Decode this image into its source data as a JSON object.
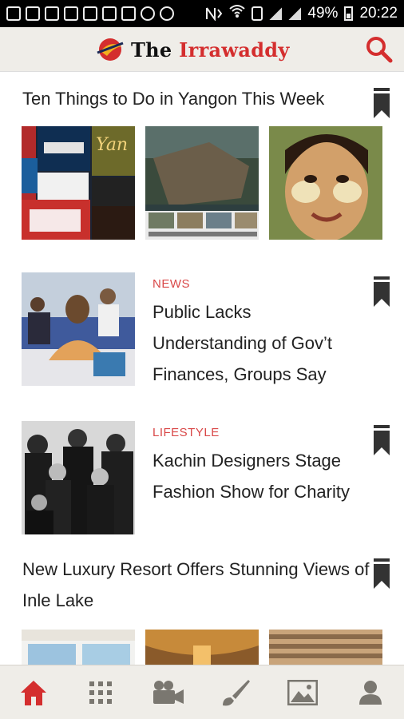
{
  "status_bar": {
    "battery": "49%",
    "time": "20:22"
  },
  "header": {
    "logo_the": "The",
    "logo_name": "Irrawaddy",
    "accent_color": "#d42e2e"
  },
  "feed": {
    "galleries": [
      {
        "title": "Ten Things to Do in Yangon This Week",
        "images": [
          "event-posters-collage",
          "flooded-house-photo",
          "thanaka-girl-painting"
        ]
      },
      {
        "title": "New Luxury Resort Offers Stunning Views of Inle Lake",
        "images": [
          "resort-room-photo",
          "resort-ceiling-photo",
          "resort-building-photo"
        ]
      }
    ],
    "articles": [
      {
        "tag": "NEWS",
        "title": "Public Lacks Understanding of Gov’t Finances, Groups Say",
        "image": "meeting-photo"
      },
      {
        "tag": "LIFESTYLE",
        "title": "Kachin Designers Stage Fashion Show for Charity",
        "image": "designers-group-photo"
      }
    ]
  },
  "bottom_nav": {
    "items": [
      "home-icon",
      "grid-icon",
      "video-camera-icon",
      "brush-icon",
      "image-icon",
      "profile-icon"
    ],
    "active": "home-icon",
    "active_color": "#d42e2e",
    "inactive_color": "#7a7770"
  }
}
